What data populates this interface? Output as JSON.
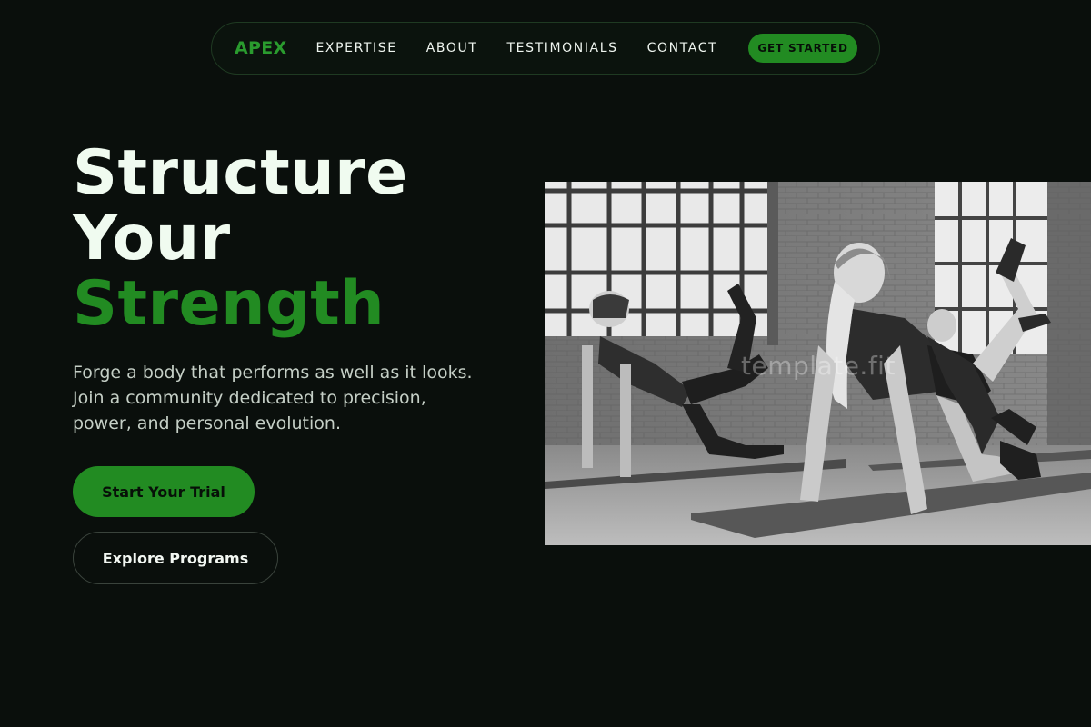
{
  "nav": {
    "logo": "APEX",
    "links": [
      "EXPERTISE",
      "ABOUT",
      "TESTIMONIALS",
      "CONTACT"
    ],
    "cta": "GET STARTED"
  },
  "hero": {
    "title_line1": "Structure",
    "title_line2": "Your",
    "title_line3": "Strength",
    "subtitle": "Forge a body that performs as well as it looks. Join a community dedicated to precision, power, and personal evolution.",
    "primary_button": "Start Your Trial",
    "secondary_button": "Explore Programs"
  },
  "image": {
    "watermark": "template.fit"
  },
  "colors": {
    "background": "#0a0f0c",
    "accent": "#228b22",
    "text": "#eef9ee",
    "muted_text": "#c5cfc6"
  }
}
